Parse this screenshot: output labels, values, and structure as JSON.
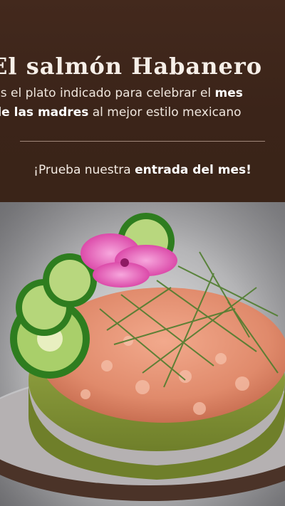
{
  "promo": {
    "title": "El salmón Habanero",
    "subtitle_line1_prefix": "Es el plato indicado para celebrar el ",
    "subtitle_line1_bold": "mes",
    "subtitle_line2_bold": "de las madres",
    "subtitle_line2_suffix": " al mejor estilo mexicano",
    "cta_prefix": "¡Prueba nuestra ",
    "cta_bold": "entrada del mes!"
  },
  "colors": {
    "background": "#3a2418",
    "text": "#f6efe8",
    "divider": "#a0887a"
  },
  "photo": {
    "subject": "salmon tartare tower with jalapeño slices, dill and a pink flower"
  }
}
